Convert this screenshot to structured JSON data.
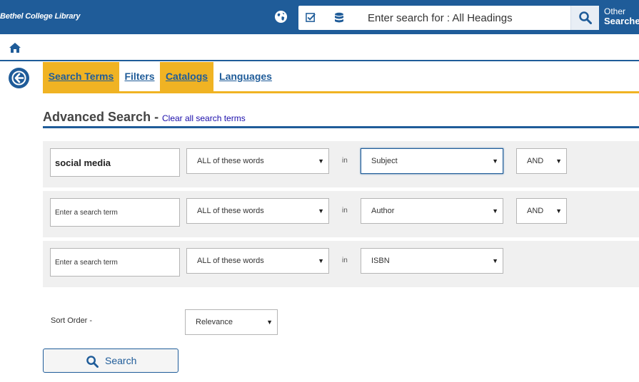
{
  "header": {
    "brand": "Bethel College Library",
    "search_placeholder": "Enter search for : All Headings",
    "other_line1": "Other",
    "other_line2": "Searches"
  },
  "tabs": [
    {
      "label": "Search Terms",
      "active": true
    },
    {
      "label": "Filters",
      "active": false
    },
    {
      "label": "Catalogs",
      "active": true
    },
    {
      "label": "Languages",
      "active": false
    }
  ],
  "heading": {
    "title": "Advanced Search -",
    "clear_link": "Clear all search terms"
  },
  "rows": [
    {
      "term_value": "social media",
      "term_placeholder": "Enter a search term",
      "match": "ALL of these words",
      "in_label": "in",
      "field": "Subject",
      "bool": "AND"
    },
    {
      "term_value": "",
      "term_placeholder": "Enter a search term",
      "match": "ALL of these words",
      "in_label": "in",
      "field": "Author",
      "bool": "AND"
    },
    {
      "term_value": "",
      "term_placeholder": "Enter a search term",
      "match": "ALL of these words",
      "in_label": "in",
      "field": "ISBN",
      "bool": ""
    }
  ],
  "sort": {
    "label": "Sort Order -",
    "value": "Relevance"
  },
  "search_button": "Search",
  "colors": {
    "primary": "#1f5c99",
    "accent": "#f0b323",
    "row_bg": "#f0f0f0"
  },
  "icons": [
    "globe-icon",
    "checkbox-list-icon",
    "database-icon",
    "search-icon",
    "home-icon",
    "back-arrow-icon",
    "dropdown-arrow-icon"
  ]
}
